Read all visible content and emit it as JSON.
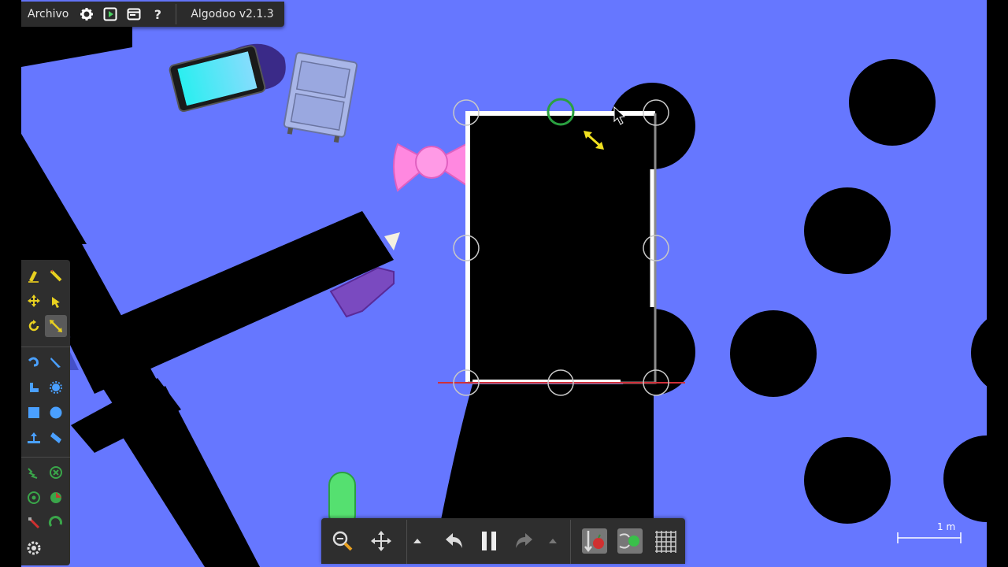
{
  "app": {
    "title": "Algodoo v2.1.3",
    "file_menu": "Archivo"
  },
  "topbar": {
    "icons": [
      "gear-icon",
      "play-scene-icon",
      "window-icon",
      "help-icon"
    ]
  },
  "sidebar": {
    "tools": [
      "sketch-tool",
      "cut-tool",
      "move-tool",
      "drag-tool",
      "rotate-tool",
      "scale-tool",
      "brush-tool",
      "knife-tool",
      "chain-tool",
      "gear-tool",
      "box-tool",
      "circle-tool",
      "plane-tool",
      "polygon-tool",
      "spring-tool",
      "fixate-tool",
      "axle-tool",
      "thruster-tool",
      "laser-tool",
      "tracer-tool",
      "texture-tool"
    ],
    "active_tool": "scale-tool"
  },
  "bottombar": {
    "controls": [
      "zoom-button",
      "pan-button",
      "speed-up-button",
      "undo-button",
      "pause-button",
      "redo-button",
      "speed-down-button",
      "gravity-toggle",
      "air-friction-toggle",
      "grid-toggle"
    ]
  },
  "scale_bar": {
    "label": "1 m"
  },
  "colors": {
    "background": "#6677ff",
    "shape": "#000000",
    "selection": "#ffffff",
    "toolbar": "#2e2e2e",
    "accent_yellow": "#e8e02a",
    "accent_green": "#3aa64a"
  }
}
